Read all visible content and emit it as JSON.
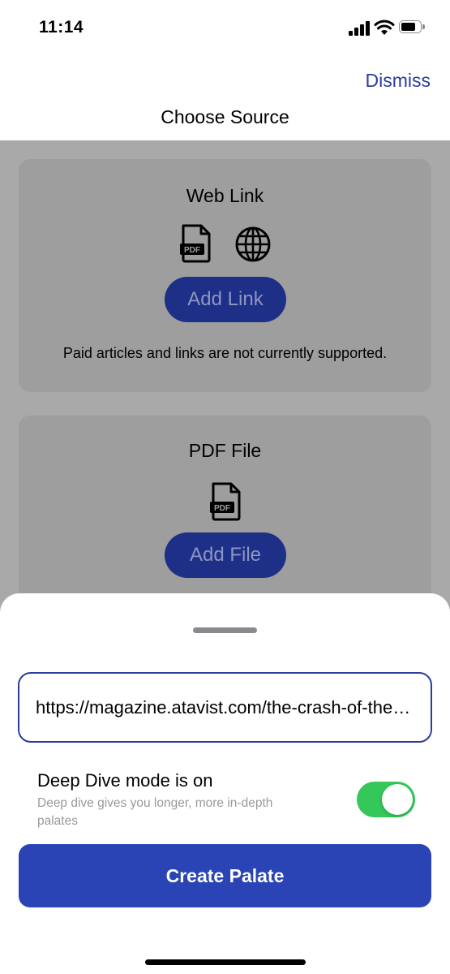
{
  "status_bar": {
    "time": "11:14"
  },
  "header": {
    "dismiss_label": "Dismiss",
    "title": "Choose Source"
  },
  "web_link_card": {
    "title": "Web Link",
    "icons": [
      "pdf-file-icon",
      "globe-icon"
    ],
    "button_label": "Add Link",
    "note": "Paid articles and links are not currently supported."
  },
  "pdf_card": {
    "title": "PDF File",
    "icons": [
      "pdf-file-icon"
    ],
    "button_label": "Add File"
  },
  "sheet": {
    "url_value": "https://magazine.atavist.com/the-crash-of-the-skyline-express",
    "deep_dive_label": "Deep Dive mode is on",
    "deep_dive_desc": "Deep dive gives you longer, more in-depth palates",
    "deep_dive_on": true,
    "create_label": "Create Palate"
  },
  "colors": {
    "accent": "#2A3D9E",
    "button": "#2A44B5",
    "toggle_on": "#34C759",
    "dim_button": "#1E2F87"
  }
}
